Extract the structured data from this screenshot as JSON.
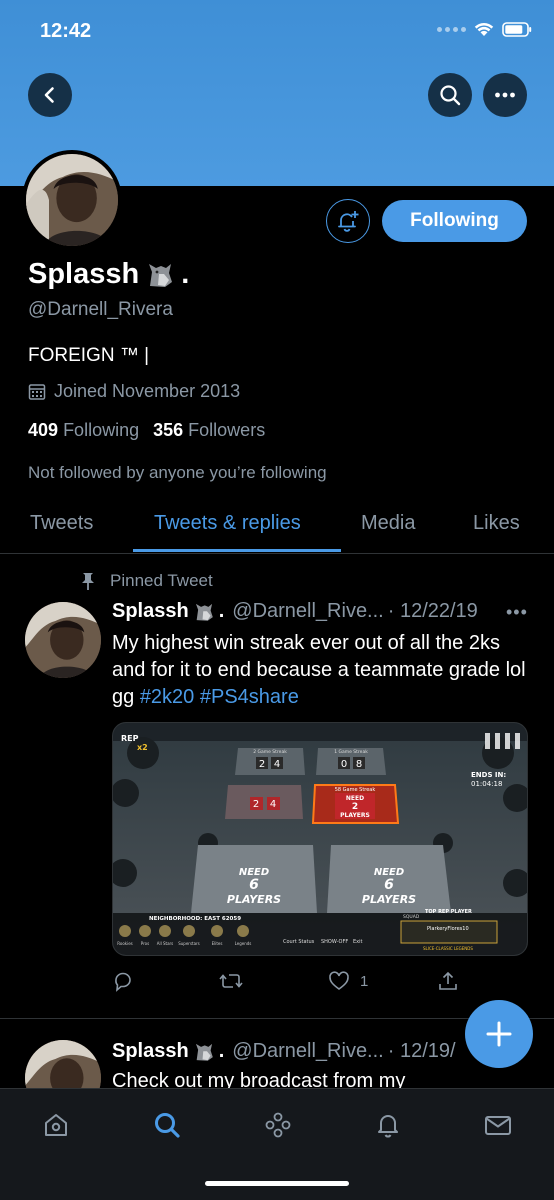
{
  "status": {
    "time": "12:42"
  },
  "profile": {
    "name": "Splassh",
    "name_suffix": ".",
    "handle": "@Darnell_Rivera",
    "bio": "FOREIGN ™ |",
    "joined": "Joined November 2013",
    "following_count": "409",
    "following_label": "Following",
    "followers_count": "356",
    "followers_label": "Followers",
    "not_followed": "Not followed by anyone you’re following",
    "follow_button": "Following"
  },
  "tabs": [
    {
      "label": "Tweets",
      "active": false
    },
    {
      "label": "Tweets & replies",
      "active": true
    },
    {
      "label": "Media",
      "active": false
    },
    {
      "label": "Likes",
      "active": false
    }
  ],
  "tweets": [
    {
      "pinned_label": "Pinned Tweet",
      "name": "Splassh",
      "name_suffix": ".",
      "handle": "@Darnell_Rive...",
      "date": "· 12/22/19",
      "more": "•••",
      "text": "My highest win streak ever out of all the 2ks and for it to end because a teammate grade lol gg",
      "hashtags": [
        "#2k20",
        "#PS4share"
      ],
      "likes": "1",
      "media": {
        "rep_label": "REP",
        "rep_mult": "x2",
        "ends_in_label": "ENDS IN:",
        "ends_in_time": "01:04:18",
        "court_top_labels": [
          "2 Game Streak",
          "1 Game Streak"
        ],
        "scores": [
          "2",
          "4",
          "0",
          "8",
          "2",
          "4"
        ],
        "streak_label": "58 Game Streak",
        "need_label": "NEED",
        "need_number": "6",
        "players_label": "PLAYERS",
        "need_small_number": "2",
        "neighborhood": "NEIGHBORHOOD: EAST 62059",
        "top_rep": "TOP REP PLAYER",
        "rep_player": "PlarkeryFlores10",
        "rep_tier": "SLICE-CLASSIC LEGENDS",
        "tiers": [
          "Rookies",
          "Pros",
          "All Stars",
          "Superstars",
          "Elites",
          "Legends"
        ],
        "court_status": "Court Status",
        "show_off": "SHOW-OFF",
        "exit": "Exit",
        "squad": "SQUAD"
      }
    },
    {
      "name": "Splassh",
      "name_suffix": ".",
      "handle": "@Darnell_Rive...",
      "date": "· 12/19/",
      "text": "Check out my broadcast from my"
    }
  ],
  "colors": {
    "accent": "#4a9ae6",
    "banner": "#4d9be0",
    "muted": "#8b98a5",
    "background": "#000000"
  },
  "icons": [
    "back-arrow-icon",
    "search-icon",
    "more-icon",
    "bell-plus-icon",
    "calendar-icon",
    "pin-icon",
    "reply-icon",
    "retweet-icon",
    "heart-icon",
    "share-icon",
    "compose-plus-icon",
    "home-icon",
    "spaces-icon",
    "notifications-icon",
    "messages-icon"
  ]
}
